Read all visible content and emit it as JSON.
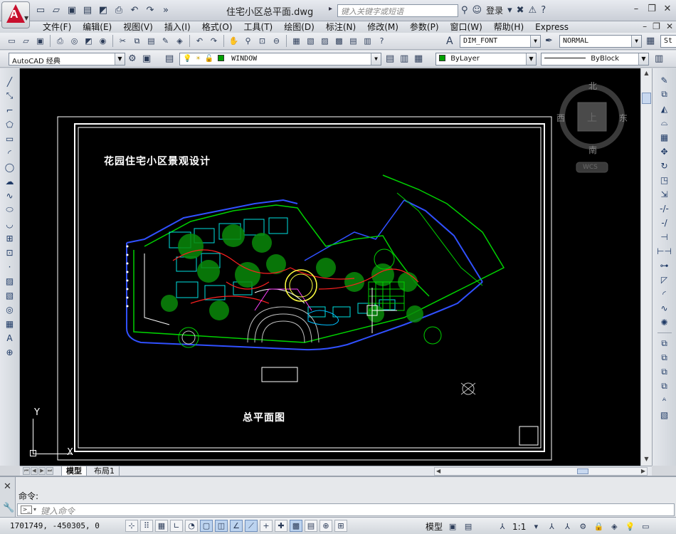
{
  "app": {
    "doc_title": "住宅小区总平面.dwg",
    "search_placeholder": "键入关键字或短语",
    "login": "登录"
  },
  "menu": [
    "文件(F)",
    "编辑(E)",
    "视图(V)",
    "插入(I)",
    "格式(O)",
    "工具(T)",
    "绘图(D)",
    "标注(N)",
    "修改(M)",
    "参数(P)",
    "窗口(W)",
    "帮助(H)",
    "Express"
  ],
  "toolbar": {
    "dim_style": "DIM_FONT",
    "plot_style": "NORMAL",
    "text_style_partial": "St",
    "workspace": "AutoCAD 经典",
    "layer": "WINDOW",
    "color": "ByLayer",
    "linetype": "ByBlock"
  },
  "viewcube": {
    "north": "北",
    "south": "南",
    "east": "东",
    "west": "西",
    "top": "上",
    "wcs": "WCS"
  },
  "drawing": {
    "title": "花园住宅小区景观设计",
    "subtitle": "总平面图"
  },
  "ucs": {
    "y": "Y",
    "x": "X"
  },
  "tabs": [
    "模型",
    "布局1"
  ],
  "command": {
    "history": "命令:",
    "placeholder": "键入命令"
  },
  "status": {
    "coords": "1701749,  -450305,  0",
    "model": "模型",
    "scale": "1:1"
  }
}
